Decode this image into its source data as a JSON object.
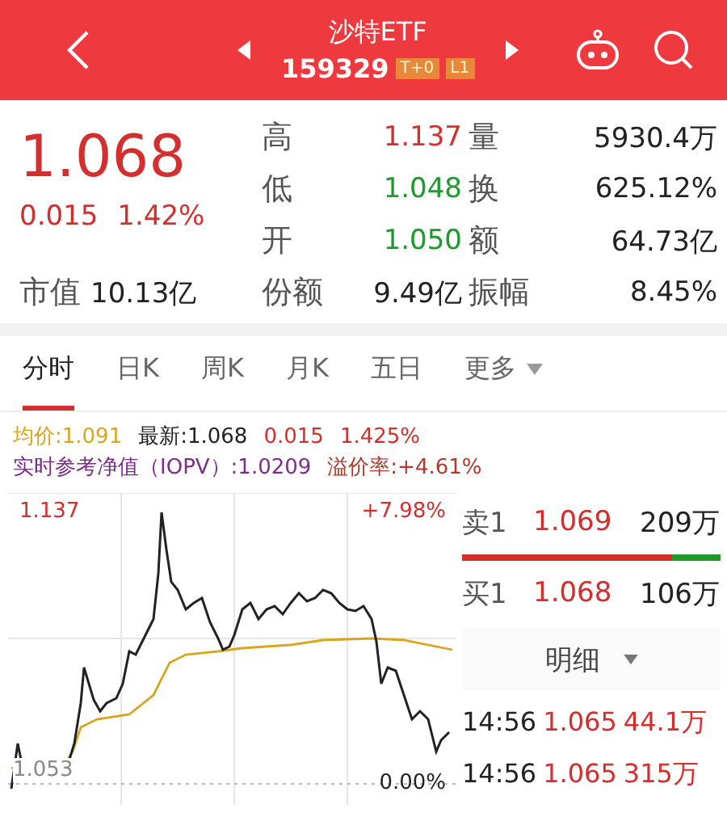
{
  "header": {
    "title": "沙特ETF",
    "code": "159329",
    "badges": [
      "T+0",
      "L1"
    ]
  },
  "quote": {
    "price": "1.068",
    "change": "0.015",
    "change_pct": "1.42%",
    "color": "#d32f2f",
    "market_cap_label": "市值",
    "market_cap": "10.13亿"
  },
  "stats": [
    {
      "label": "高",
      "value": "1.137",
      "color": "#d32f2f"
    },
    {
      "label": "量",
      "value": "5930.4万",
      "color": "#222222"
    },
    {
      "label": "低",
      "value": "1.048",
      "color": "#1e9a2e"
    },
    {
      "label": "换",
      "value": "625.12%",
      "color": "#222222"
    },
    {
      "label": "开",
      "value": "1.050",
      "color": "#1e9a2e"
    },
    {
      "label": "额",
      "value": "64.73亿",
      "color": "#222222"
    },
    {
      "label": "份额",
      "value": "9.49亿",
      "color": "#222222"
    },
    {
      "label": "振幅",
      "value": "8.45%",
      "color": "#222222"
    }
  ],
  "tabs": [
    {
      "label": "分时",
      "selected": true
    },
    {
      "label": "日K",
      "selected": false
    },
    {
      "label": "周K",
      "selected": false
    },
    {
      "label": "月K",
      "selected": false
    },
    {
      "label": "五日",
      "selected": false
    },
    {
      "label": "更多",
      "selected": false,
      "dropdown": true
    }
  ],
  "info": {
    "avg": "均价:1.091",
    "latest": "最新:1.068",
    "change": "0.015",
    "change_pct": "1.425%",
    "iopv": "实时参考净值（IOPV）:1.0209",
    "premium": "溢价率:+4.61%"
  },
  "chart": {
    "high": "1.137",
    "high_pct": "+7.98%",
    "low": "1.053",
    "low_pct": "0.00%"
  },
  "order_book": {
    "asks": [
      {
        "label": "卖1",
        "price": "1.069",
        "volume": "209万"
      }
    ],
    "bids": [
      {
        "label": "买1",
        "price": "1.068",
        "volume": "106万"
      }
    ],
    "level": 0.81
  },
  "details_button": "明细",
  "trades": [
    {
      "time": "14:56",
      "price": "1.065",
      "volume": "44.1万"
    },
    {
      "time": "14:56",
      "price": "1.065",
      "volume": "315万"
    }
  ]
}
